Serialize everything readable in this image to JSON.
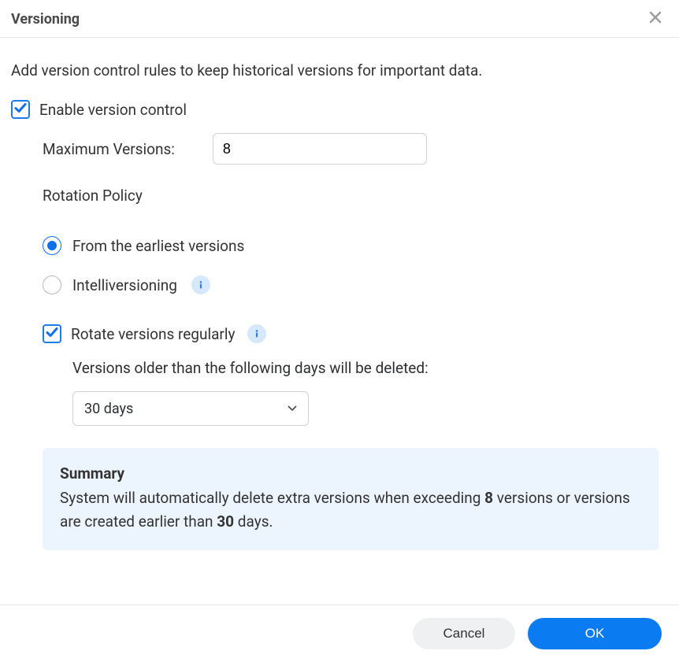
{
  "dialog": {
    "title": "Versioning",
    "description": "Add version control rules to keep historical versions for important data.",
    "close_label": "Close"
  },
  "enable": {
    "label": "Enable version control",
    "checked": true
  },
  "max_versions": {
    "label": "Maximum Versions:",
    "value": "8"
  },
  "rotation_policy": {
    "label": "Rotation Policy",
    "options": {
      "earliest": {
        "label": "From the earliest versions",
        "selected": true
      },
      "intelli": {
        "label": "Intelliversioning",
        "selected": false
      }
    }
  },
  "rotate_regularly": {
    "label": "Rotate versions regularly",
    "checked": true,
    "description": "Versions older than the following days will be deleted:",
    "select": {
      "value_label": "30 days",
      "value_days": 30
    }
  },
  "summary": {
    "title": "Summary",
    "text_pre": "System will automatically delete extra versions when exceeding ",
    "bold1": "8",
    "text_mid": " versions or versions are created earlier than ",
    "bold2": "30",
    "text_post": " days."
  },
  "footer": {
    "cancel": "Cancel",
    "ok": "OK"
  },
  "icons": {
    "info": "info-icon",
    "close": "close-icon",
    "check": "check-icon",
    "chevron_down": "chevron-down-icon"
  },
  "colors": {
    "accent": "#0a7bf0",
    "info_bg": "#d6e8fb",
    "summary_bg": "#ecf4fd"
  }
}
